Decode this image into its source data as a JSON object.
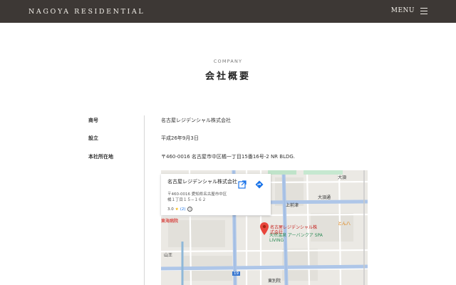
{
  "header": {
    "logo": "NAGOYA RESIDENTIAL",
    "menu_label": "MENU"
  },
  "section": {
    "eyebrow": "COMPANY",
    "title": "会社概要"
  },
  "company_rows": [
    {
      "label": "商号",
      "value": "名古屋レジデンシャル株式会社"
    },
    {
      "label": "設立",
      "value": "平成26年9月3日"
    },
    {
      "label": "本社所在地",
      "value": "〒460-0016 名古屋市中区橘一丁目15番16号-2 NR BLDG."
    }
  ],
  "map": {
    "place_name": "名古屋レジデンシャル株式会社",
    "address_line1": "〒460-0016 愛知県名古屋市中区",
    "address_line2": "橘１丁目１５−１６２",
    "rating": "3.0",
    "star": "★",
    "reviews": "(2)",
    "info_glyph": "i",
    "pin_label": "名古屋レジデンシャル株式会社",
    "labels": {
      "hospital": "東海病院",
      "kamimaezu": "上前津",
      "yamaou": "山王",
      "onsen": "天然温泉 アーバンクア SPA LIVING",
      "tonhachi": "とん八",
      "higashibetsuin": "東別院",
      "ozu": "大須",
      "ozu_dori": "大須通",
      "road_19": "19"
    },
    "icons": {
      "open": "open-in-new-icon",
      "directions": "directions-icon",
      "pin": "map-pin-icon"
    }
  }
}
